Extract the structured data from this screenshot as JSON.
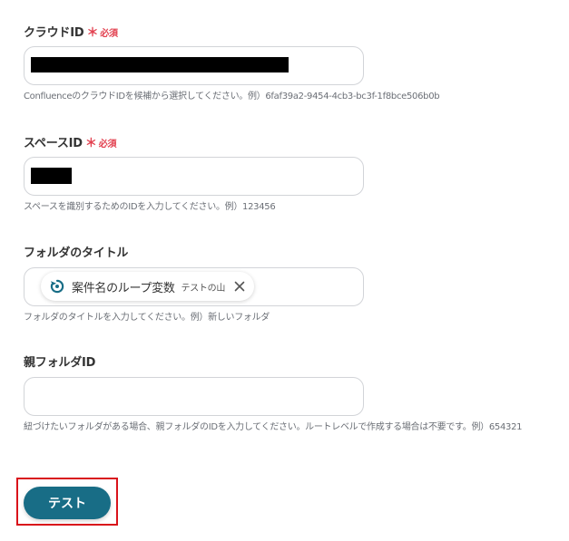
{
  "fields": {
    "cloud_id": {
      "label": "クラウドID",
      "required_star": "＊",
      "required_text": "必須",
      "help": "ConfluenceのクラウドIDを候補から選択してください。例）6faf39a2-9454-4cb3-bc3f-1f8bce506b0b"
    },
    "space_id": {
      "label": "スペースID",
      "required_star": "＊",
      "required_text": "必須",
      "help": "スペースを識別するためのIDを入力してください。例）123456"
    },
    "folder_title": {
      "label": "フォルダのタイトル",
      "chip_name": "案件名のループ変数",
      "chip_value": "テストの山",
      "help": "フォルダのタイトルを入力してください。例）新しいフォルダ"
    },
    "parent_folder_id": {
      "label": "親フォルダID",
      "value": "",
      "help": "紐づけたいフォルダがある場合、親フォルダのIDを入力してください。ルートレベルで作成する場合は不要です。例）654321"
    }
  },
  "actions": {
    "test_label": "テスト"
  },
  "colors": {
    "required": "#e2404f",
    "button": "#186d86",
    "highlight_frame": "#d9131b"
  },
  "icons": {
    "chip_icon": "loop-icon",
    "chip_remove": "close-icon"
  }
}
